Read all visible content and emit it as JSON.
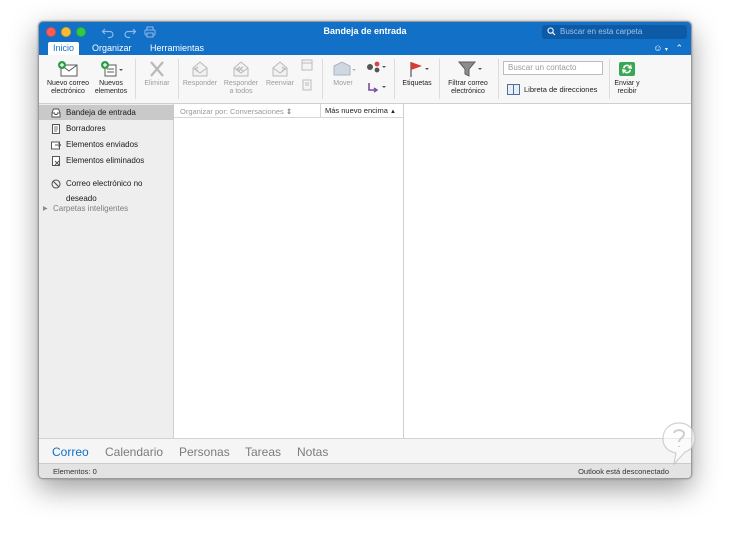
{
  "window": {
    "title": "Bandeja de entrada"
  },
  "search": {
    "placeholder": "Buscar en esta carpeta"
  },
  "tabs": [
    {
      "label": "Inicio"
    },
    {
      "label": "Organizar"
    },
    {
      "label": "Herramientas"
    }
  ],
  "ribbon": {
    "new_email": "Nuevo correo electrónico",
    "new_items": "Nuevos elementos",
    "delete": "Eliminar",
    "reply": "Responder",
    "reply_all": "Responder a todos",
    "forward": "Reenviar",
    "move": "Mover",
    "tags": "Etiquetas",
    "filter": "Filtrar correo electrónico",
    "contact_placeholder": "Buscar un contacto",
    "address_book": "Libreta de direcciones",
    "send_receive": "Enviar y recibir"
  },
  "sidebar": {
    "items": [
      {
        "label": "Bandeja de entrada",
        "icon": "inbox-icon",
        "selected": true
      },
      {
        "label": "Borradores",
        "icon": "drafts-icon"
      },
      {
        "label": "Elementos enviados",
        "icon": "sent-icon"
      },
      {
        "label": "Elementos eliminados",
        "icon": "deleted-icon"
      },
      {
        "label": "Correo electrónico no deseado",
        "icon": "junk-icon"
      }
    ],
    "group": "Carpetas inteligentes"
  },
  "maillist": {
    "sort_by": "Organizar por: Conversaciones",
    "order": "Más nuevo encima"
  },
  "nav": [
    {
      "label": "Correo",
      "active": true
    },
    {
      "label": "Calendario"
    },
    {
      "label": "Personas"
    },
    {
      "label": "Tareas"
    },
    {
      "label": "Notas"
    }
  ],
  "status": {
    "items": "Elementos: 0",
    "connection": "Outlook está desconectado"
  },
  "colors": {
    "accent": "#1270c6",
    "sidebar_bg": "#eeeeee",
    "ribbon_bg": "#f7f7f7"
  }
}
